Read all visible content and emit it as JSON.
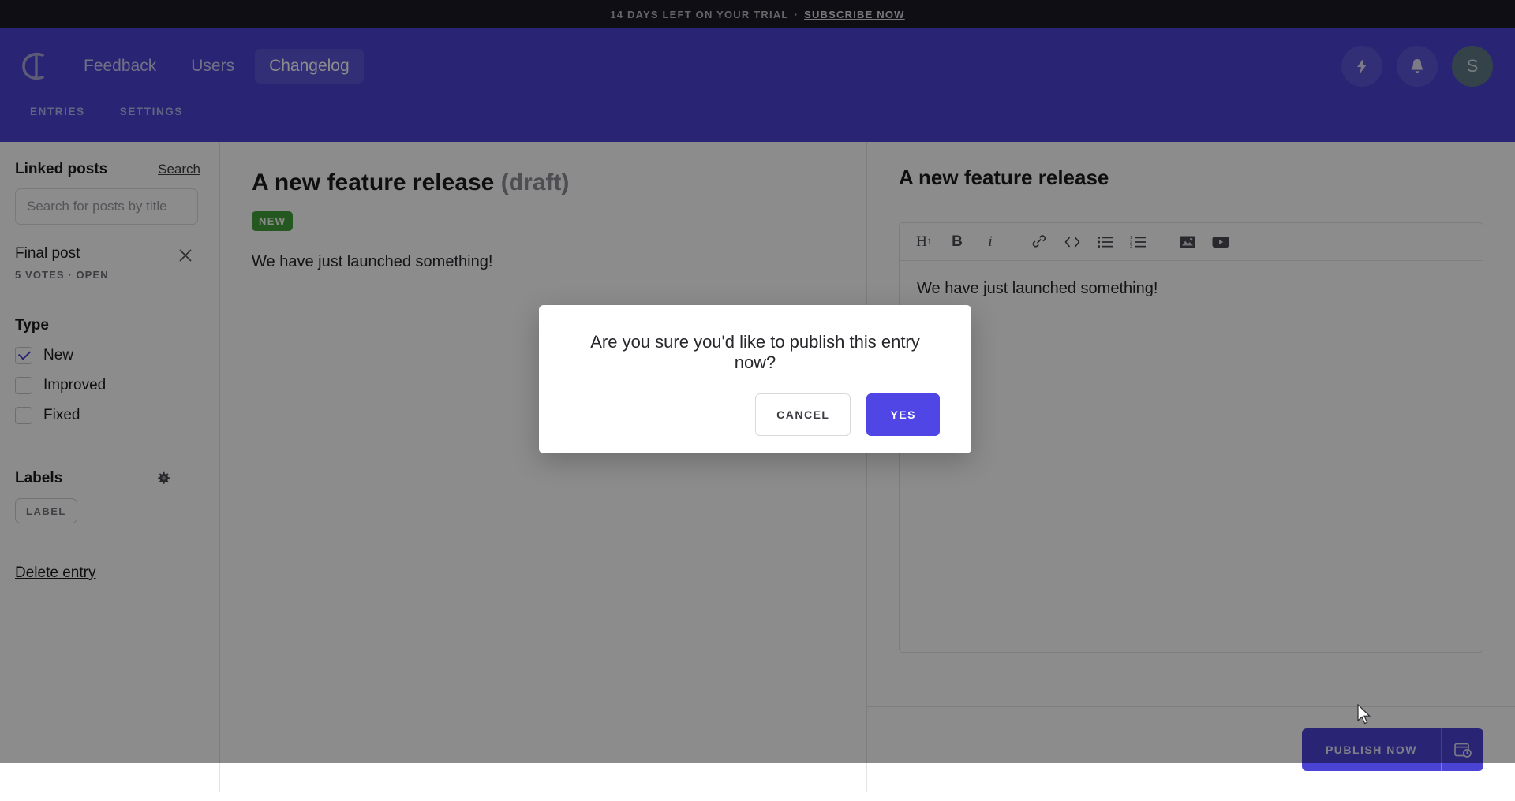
{
  "banner": {
    "trial_text": "14 DAYS LEFT ON YOUR TRIAL",
    "separator": "·",
    "cta_label": "SUBSCRIBE NOW"
  },
  "header": {
    "logo_name": "canny-logo",
    "nav": [
      {
        "label": "Feedback",
        "active": false
      },
      {
        "label": "Users",
        "active": false
      },
      {
        "label": "Changelog",
        "active": true
      }
    ],
    "actions": [
      {
        "icon": "lightning-bolt-icon"
      },
      {
        "icon": "bell-icon"
      }
    ],
    "avatar_initial": "S",
    "subtabs": [
      {
        "label": "ENTRIES"
      },
      {
        "label": "SETTINGS"
      }
    ]
  },
  "sidebar": {
    "linked_posts_title": "Linked posts",
    "search_link_label": "Search",
    "search_placeholder": "Search for posts by title",
    "search_value": "",
    "linked_post": {
      "name": "Final post",
      "meta": "5 VOTES · OPEN",
      "remove_icon": "close-icon"
    },
    "type_section_title": "Type",
    "types": [
      {
        "label": "New",
        "checked": true
      },
      {
        "label": "Improved",
        "checked": false
      },
      {
        "label": "Fixed",
        "checked": false
      }
    ],
    "labels_section_title": "Labels",
    "labels_settings_icon": "gear-icon",
    "label_chip": "LABEL",
    "delete_entry_label": "Delete entry"
  },
  "preview": {
    "title": "A new feature release",
    "status_suffix": "(draft)",
    "badge": "NEW",
    "badge_color": "#44a03c",
    "body": "We have just launched something!"
  },
  "editor": {
    "title": "A new feature release",
    "toolbar": [
      {
        "icon": "heading-1-icon",
        "label": "H1"
      },
      {
        "icon": "bold-icon",
        "label": "B"
      },
      {
        "icon": "italic-icon",
        "label": "i"
      },
      {
        "icon": "link-icon"
      },
      {
        "icon": "code-icon"
      },
      {
        "icon": "bullet-list-icon"
      },
      {
        "icon": "numbered-list-icon"
      },
      {
        "icon": "image-icon"
      },
      {
        "icon": "youtube-video-icon"
      }
    ],
    "content": "We have just launched something!",
    "publish_label": "PUBLISH NOW",
    "schedule_icon": "calendar-clock-icon",
    "accent_color": "#4b43d4"
  },
  "modal": {
    "message": "Are you sure you'd like to publish this entry now?",
    "cancel_label": "CANCEL",
    "confirm_label": "YES",
    "confirm_color": "#4f46e5"
  }
}
